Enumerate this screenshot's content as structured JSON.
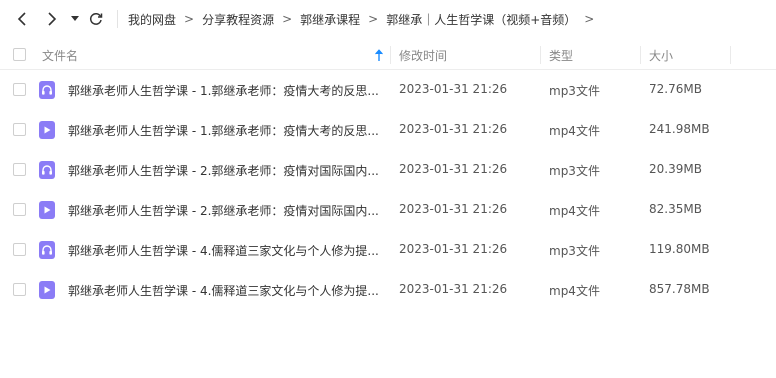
{
  "toolbar": {
    "back_icon": "chevron-left-icon",
    "forward_icon": "chevron-right-icon",
    "dropdown_icon": "caret-down-icon",
    "refresh_icon": "refresh-icon"
  },
  "breadcrumb": {
    "items": [
      "我的网盘",
      "分享教程资源",
      "郭继承课程",
      "郭继承｜人生哲学课（视频+音频）"
    ],
    "separator": ">"
  },
  "columns": {
    "name": "文件名",
    "modified": "修改时间",
    "type": "类型",
    "size": "大小",
    "sort_icon": "sort-ascending-icon"
  },
  "colors": {
    "accent": "#1a8cff",
    "file_icon": "#8b7cf6"
  },
  "files": [
    {
      "icon": "headphones-icon",
      "name": "郭继承老师人生哲学课 - 1.郭继承老师：疫情大考的反思...",
      "modified": "2023-01-31 21:26",
      "type": "mp3文件",
      "size": "72.76MB"
    },
    {
      "icon": "play-icon",
      "name": "郭继承老师人生哲学课 - 1.郭继承老师：疫情大考的反思...",
      "modified": "2023-01-31 21:26",
      "type": "mp4文件",
      "size": "241.98MB"
    },
    {
      "icon": "headphones-icon",
      "name": "郭继承老师人生哲学课 - 2.郭继承老师：疫情对国际国内...",
      "modified": "2023-01-31 21:26",
      "type": "mp3文件",
      "size": "20.39MB"
    },
    {
      "icon": "play-icon",
      "name": "郭继承老师人生哲学课 - 2.郭继承老师：疫情对国际国内...",
      "modified": "2023-01-31 21:26",
      "type": "mp4文件",
      "size": "82.35MB"
    },
    {
      "icon": "headphones-icon",
      "name": "郭继承老师人生哲学课 - 4.儒释道三家文化与个人修为提...",
      "modified": "2023-01-31 21:26",
      "type": "mp3文件",
      "size": "119.80MB"
    },
    {
      "icon": "play-icon",
      "name": "郭继承老师人生哲学课 - 4.儒释道三家文化与个人修为提...",
      "modified": "2023-01-31 21:26",
      "type": "mp4文件",
      "size": "857.78MB"
    }
  ]
}
